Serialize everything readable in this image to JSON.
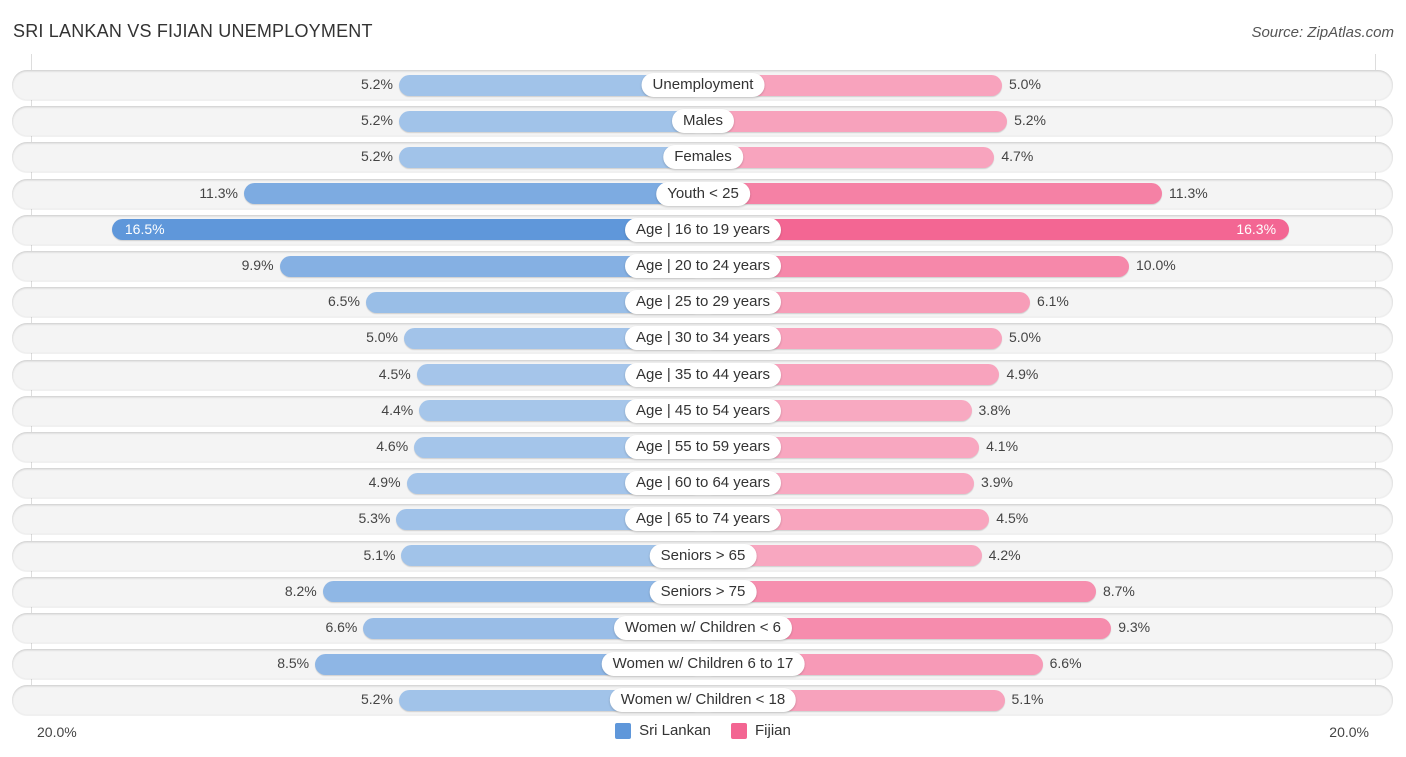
{
  "header": {
    "title": "SRI LANKAN VS FIJIAN UNEMPLOYMENT",
    "source": "Source: ZipAtlas.com"
  },
  "colors": {
    "sri_lankan_light": "#a9c8eb",
    "sri_lankan_strong": "#5f97da",
    "fijian_light": "#f8a9c1",
    "fijian_strong": "#f36592"
  },
  "chart_data": {
    "type": "bar",
    "orientation": "horizontal-diverging",
    "title": "SRI LANKAN VS FIJIAN UNEMPLOYMENT",
    "xlabel": "",
    "ylabel": "",
    "xlim": [
      -20,
      20
    ],
    "axis_tick_left": "20.0%",
    "axis_tick_right": "20.0%",
    "legend_position": "bottom-center",
    "categories": [
      "Unemployment",
      "Males",
      "Females",
      "Youth < 25",
      "Age | 16 to 19 years",
      "Age | 20 to 24 years",
      "Age | 25 to 29 years",
      "Age | 30 to 34 years",
      "Age | 35 to 44 years",
      "Age | 45 to 54 years",
      "Age | 55 to 59 years",
      "Age | 60 to 64 years",
      "Age | 65 to 74 years",
      "Seniors > 65",
      "Seniors > 75",
      "Women w/ Children < 6",
      "Women w/ Children 6 to 17",
      "Women w/ Children < 18"
    ],
    "series": [
      {
        "name": "Sri Lankan",
        "side": "left",
        "values": [
          5.2,
          5.2,
          5.2,
          11.3,
          16.5,
          9.9,
          6.5,
          5.0,
          4.5,
          4.4,
          4.6,
          4.9,
          5.3,
          5.1,
          8.2,
          6.6,
          8.5,
          5.2
        ],
        "labels": [
          "5.2%",
          "5.2%",
          "5.2%",
          "11.3%",
          "16.5%",
          "9.9%",
          "6.5%",
          "5.0%",
          "4.5%",
          "4.4%",
          "4.6%",
          "4.9%",
          "5.3%",
          "5.1%",
          "8.2%",
          "6.6%",
          "8.5%",
          "5.2%"
        ]
      },
      {
        "name": "Fijian",
        "side": "right",
        "values": [
          5.0,
          5.2,
          4.7,
          11.3,
          16.3,
          10.0,
          6.1,
          5.0,
          4.9,
          3.8,
          4.1,
          3.9,
          4.5,
          4.2,
          8.7,
          9.3,
          6.6,
          5.1
        ],
        "labels": [
          "5.0%",
          "5.2%",
          "4.7%",
          "11.3%",
          "16.3%",
          "10.0%",
          "6.1%",
          "5.0%",
          "4.9%",
          "3.8%",
          "4.1%",
          "3.9%",
          "4.5%",
          "4.2%",
          "8.7%",
          "9.3%",
          "6.6%",
          "5.1%"
        ]
      }
    ]
  },
  "legend": {
    "items": [
      {
        "label": "Sri Lankan",
        "color": "#5f97da"
      },
      {
        "label": "Fijian",
        "color": "#f36592"
      }
    ]
  }
}
